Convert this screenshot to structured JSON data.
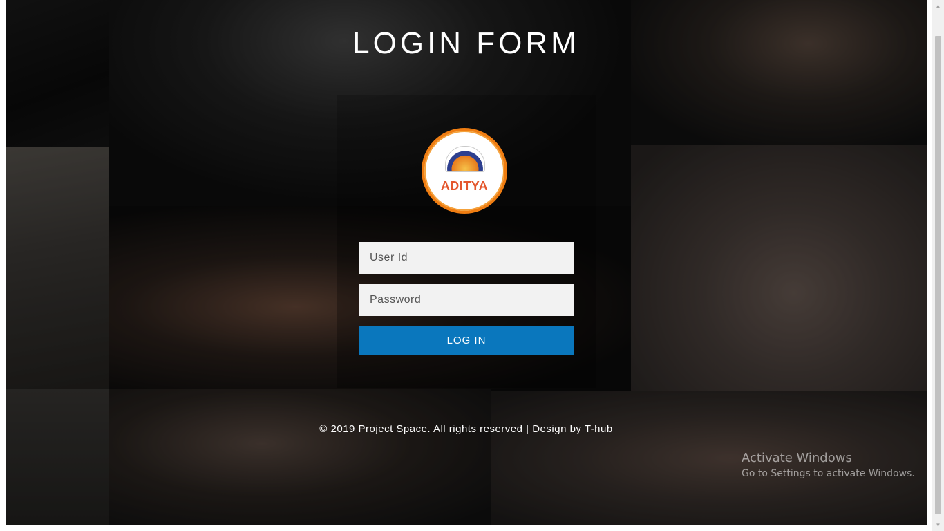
{
  "header": {
    "title": "LOGIN FORM"
  },
  "logo": {
    "text": "ADITYA"
  },
  "form": {
    "user_id_placeholder": "User Id",
    "password_placeholder": "Password",
    "login_label": "LOG IN"
  },
  "footer": {
    "text": "© 2019 Project Space. All rights reserved | Design by",
    "link_text": "T-hub"
  },
  "watermark": {
    "title": "Activate Windows",
    "subtitle": "Go to Settings to activate Windows."
  },
  "colors": {
    "button": "#0a77bd",
    "logo_ring": "#ef7d12",
    "logo_text": "#e4572e"
  },
  "icons": [
    "chevron-up-icon",
    "chevron-down-icon"
  ]
}
